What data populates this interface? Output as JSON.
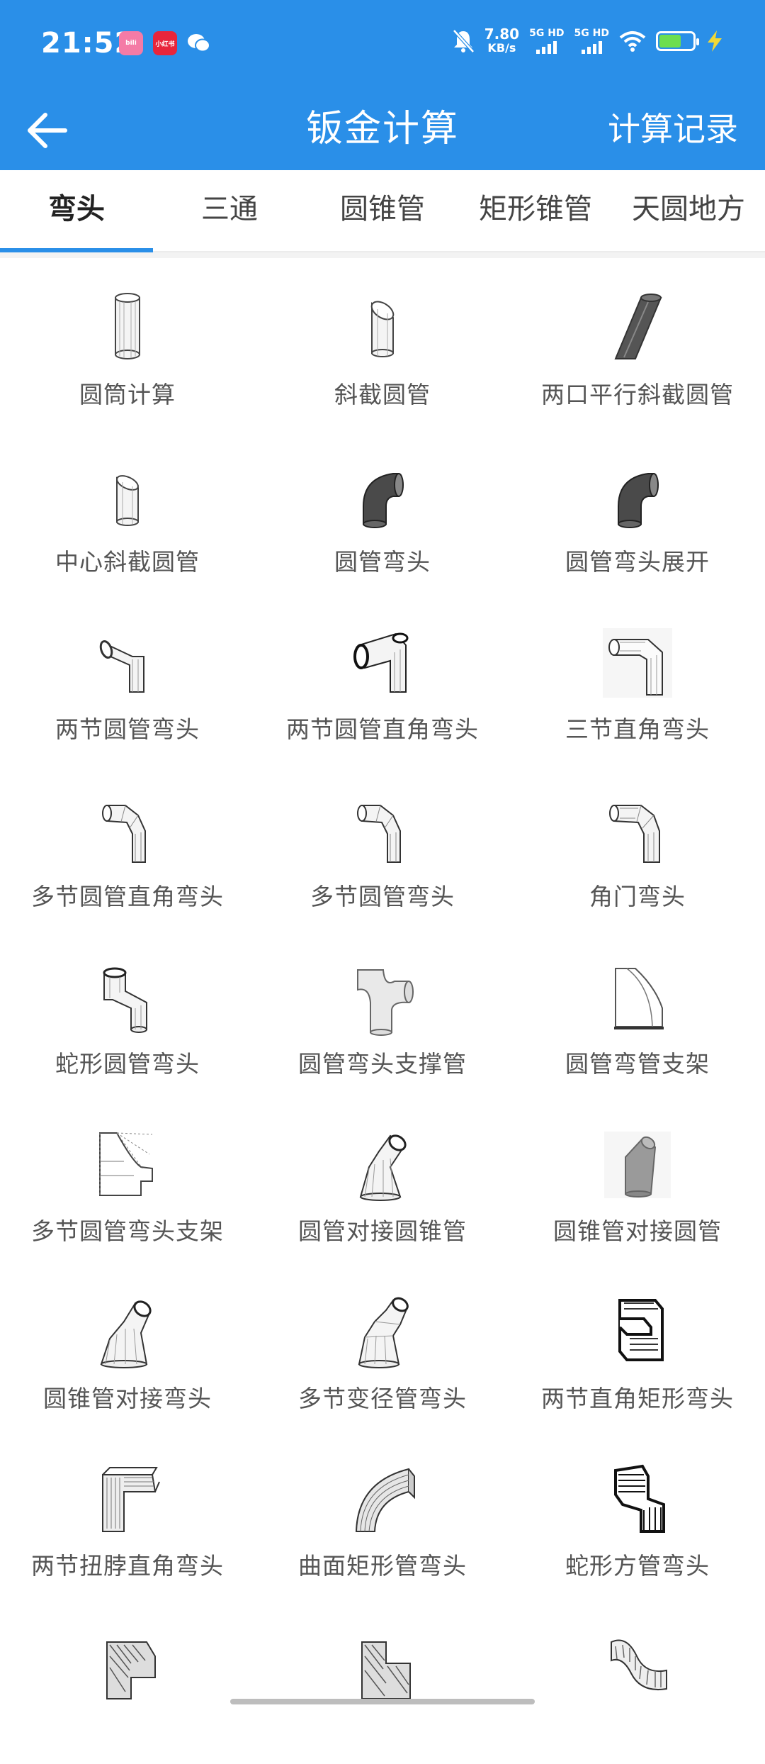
{
  "status_bar": {
    "time": "21:52",
    "apps": [
      {
        "name": "bilibili-icon",
        "label": "bili",
        "color": "#f47ba6"
      },
      {
        "name": "xiaohongshu-icon",
        "label": "小红书",
        "color": "#e8253b"
      },
      {
        "name": "wechat-icon",
        "label": "",
        "color": "#ffffff"
      }
    ],
    "net_speed": "7.80",
    "net_unit": "KB/s",
    "sim1": "5G HD",
    "sim2": "5G HD",
    "battery_percent": 60
  },
  "app_bar": {
    "title": "钣金计算",
    "history_label": "计算记录"
  },
  "tabs": [
    {
      "label": "弯头",
      "active": true
    },
    {
      "label": "三通",
      "active": false
    },
    {
      "label": "圆锥管",
      "active": false
    },
    {
      "label": "矩形锥管",
      "active": false
    },
    {
      "label": "天圆地方",
      "active": false
    }
  ],
  "items": [
    {
      "label": "圆筒计算",
      "icon": "cylinder-icon"
    },
    {
      "label": "斜截圆管",
      "icon": "oblique-cut-pipe-icon"
    },
    {
      "label": "两口平行斜截圆管",
      "icon": "parallel-oblique-pipe-icon"
    },
    {
      "label": "中心斜截圆管",
      "icon": "center-oblique-pipe-icon"
    },
    {
      "label": "圆管弯头",
      "icon": "pipe-elbow-icon"
    },
    {
      "label": "圆管弯头展开",
      "icon": "pipe-elbow-unfold-icon"
    },
    {
      "label": "两节圆管弯头",
      "icon": "two-segment-elbow-icon"
    },
    {
      "label": "两节圆管直角弯头",
      "icon": "two-segment-right-elbow-icon"
    },
    {
      "label": "三节直角弯头",
      "icon": "three-segment-right-elbow-icon"
    },
    {
      "label": "多节圆管直角弯头",
      "icon": "multi-segment-right-elbow-icon"
    },
    {
      "label": "多节圆管弯头",
      "icon": "multi-segment-elbow-icon"
    },
    {
      "label": "角门弯头",
      "icon": "corner-door-elbow-icon"
    },
    {
      "label": "蛇形圆管弯头",
      "icon": "snake-pipe-elbow-icon"
    },
    {
      "label": "圆管弯头支撑管",
      "icon": "elbow-support-pipe-icon"
    },
    {
      "label": "圆管弯管支架",
      "icon": "bent-pipe-bracket-icon"
    },
    {
      "label": "多节圆管弯头支架",
      "icon": "multi-segment-elbow-bracket-icon"
    },
    {
      "label": "圆管对接圆锥管",
      "icon": "pipe-to-cone-icon"
    },
    {
      "label": "圆锥管对接圆管",
      "icon": "cone-to-pipe-icon"
    },
    {
      "label": "圆锥管对接弯头",
      "icon": "cone-elbow-icon"
    },
    {
      "label": "多节变径管弯头",
      "icon": "multi-reducer-elbow-icon"
    },
    {
      "label": "两节直角矩形弯头",
      "icon": "two-segment-rect-elbow-icon"
    },
    {
      "label": "两节扭脖直角弯头",
      "icon": "twisted-neck-elbow-icon"
    },
    {
      "label": "曲面矩形管弯头",
      "icon": "curved-rect-elbow-icon"
    },
    {
      "label": "蛇形方管弯头",
      "icon": "snake-square-elbow-icon"
    },
    {
      "label": "",
      "icon": "rect-elbow-partial-icon"
    },
    {
      "label": "",
      "icon": "rect-elbow-partial-icon"
    },
    {
      "label": "",
      "icon": "curved-strip-elbow-icon"
    }
  ]
}
